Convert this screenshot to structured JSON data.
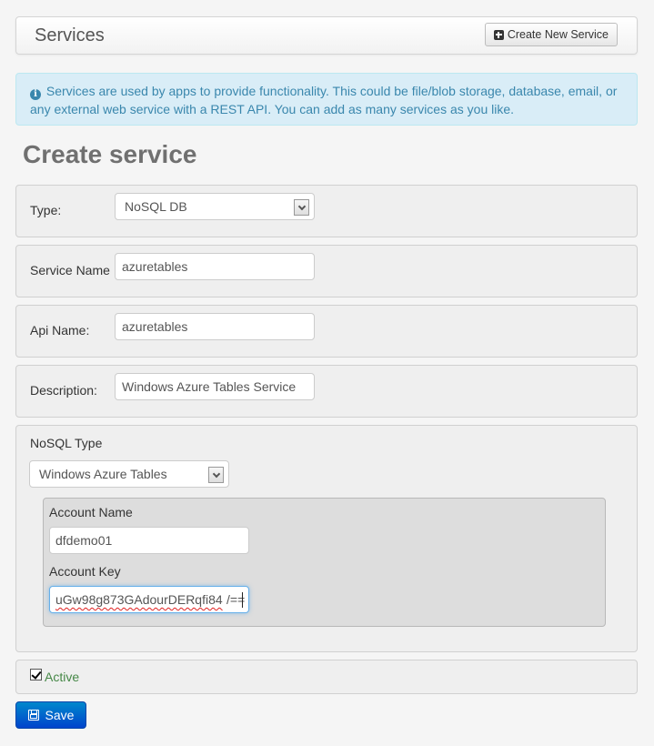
{
  "header": {
    "title": "Services",
    "create_button_label": "Create New Service",
    "create_button_icon": "plus-square-icon"
  },
  "info_alert": {
    "icon": "info-circle-icon",
    "text": "Services are used by apps to provide functionality. This could be file/blob storage, database, email, or any external web service with a REST API. You can add as many services as you like."
  },
  "page_title": "Create service",
  "form": {
    "type": {
      "label": "Type:",
      "selected": "NoSQL DB"
    },
    "service_name": {
      "label": "Service Name",
      "value": "azuretables"
    },
    "api_name": {
      "label": "Api Name:",
      "value": "azuretables"
    },
    "description": {
      "label": "Description:",
      "value": "Windows Azure Tables Service"
    },
    "nosql_type": {
      "label": "NoSQL Type",
      "selected": "Windows Azure Tables",
      "account_name": {
        "label": "Account Name",
        "value": "dfdemo01"
      },
      "account_key": {
        "label": "Account Key",
        "value_misspelled": "uGw98g873GAdourDERqfi84",
        "value_suffix": "/==",
        "value": "uGw98g873GAdourDERqfi84/=="
      }
    },
    "active": {
      "label": "Active",
      "checked": true
    }
  },
  "save_button": {
    "label": "Save",
    "icon": "floppy-disk-icon"
  },
  "colors": {
    "primary": "#0055cc",
    "info_text": "#3a87ad",
    "info_bg": "#d9edf7",
    "success_text": "#468847"
  }
}
